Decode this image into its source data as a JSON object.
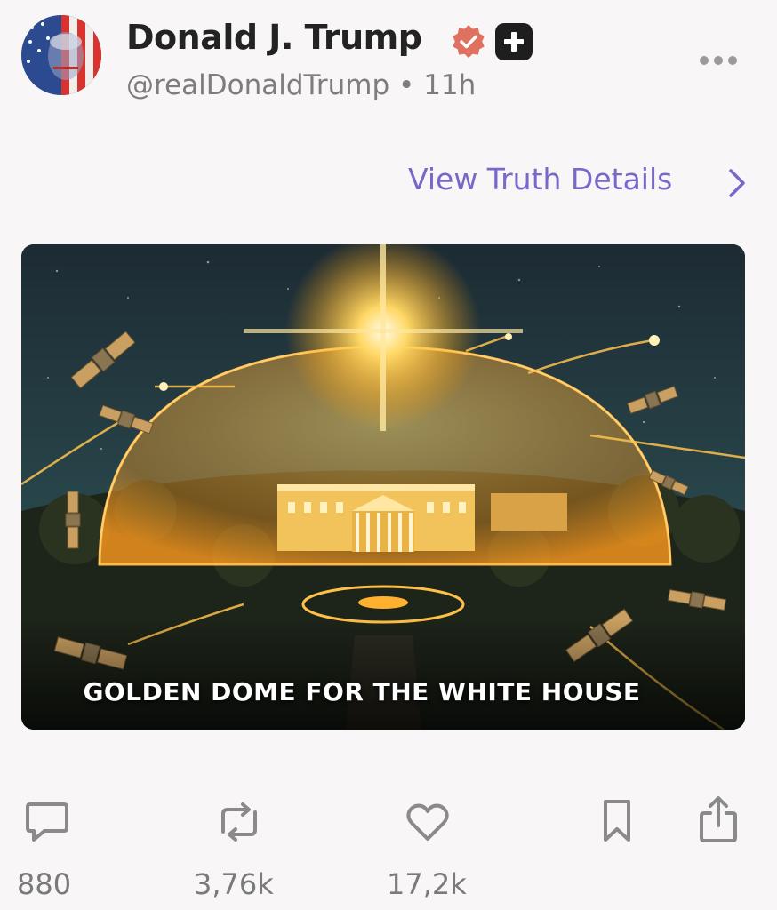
{
  "post": {
    "author": {
      "display_name": "Donald J. Trump",
      "handle": "@realDonaldTrump",
      "time": "11h",
      "separator": "•",
      "verified_icon": "verified-badge-icon",
      "plus_icon": "plus-icon"
    },
    "view_details_label": "View Truth Details",
    "media": {
      "caption": "GOLDEN DOME FOR THE WHITE HOUSE"
    },
    "actions": {
      "replies": "880",
      "retruths": "3,76k",
      "likes": "17,2k"
    }
  },
  "colors": {
    "accent": "#7b67c9",
    "verified": "#e0705f",
    "icon_gray": "#8a8a8a",
    "background": "#f8f6f6"
  }
}
